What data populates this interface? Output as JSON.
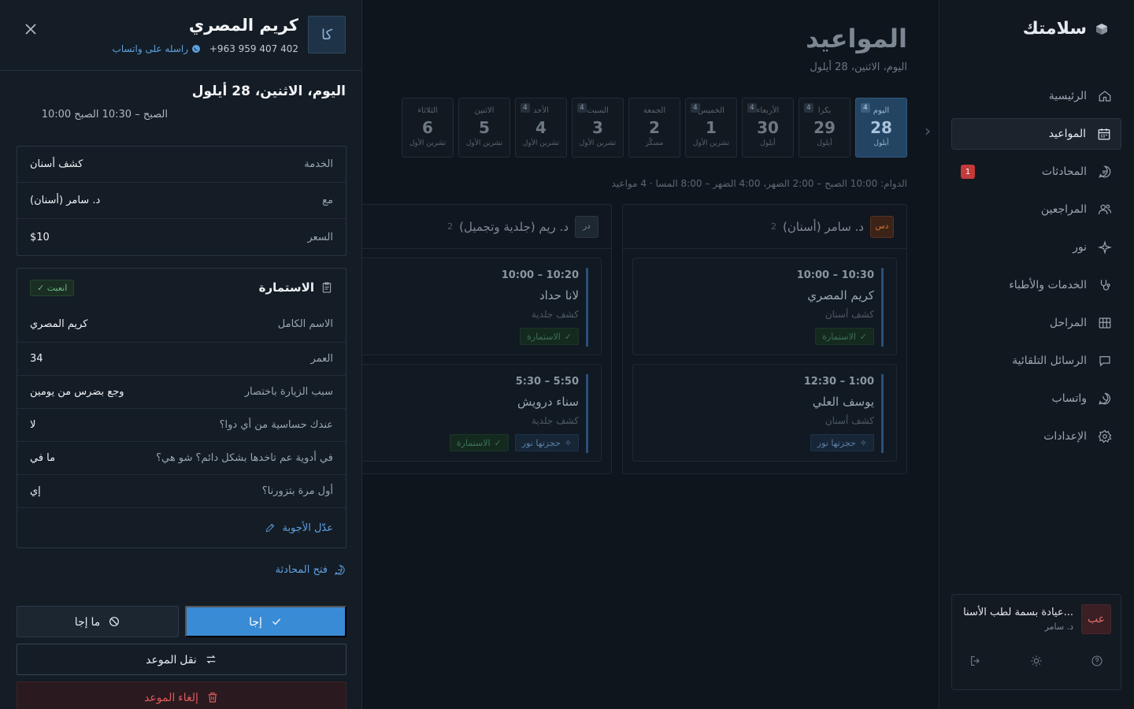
{
  "sidebar": {
    "brand": "سلامتك",
    "items": [
      {
        "label": "الرئيسية",
        "icon": "home-icon"
      },
      {
        "label": "المواعيد",
        "icon": "calendar-icon",
        "active": true
      },
      {
        "label": "المحادثات",
        "icon": "chat-icon",
        "badge": "1"
      },
      {
        "label": "المراجعين",
        "icon": "users-icon"
      },
      {
        "label": "نور",
        "icon": "sparkle-icon"
      },
      {
        "label": "الخدمات والأطباء",
        "icon": "stethoscope-icon"
      },
      {
        "label": "المراحل",
        "icon": "kanban-icon"
      },
      {
        "label": "الرسائل التلقائية",
        "icon": "message-icon"
      },
      {
        "label": "واتساب",
        "icon": "whatsapp-icon"
      },
      {
        "label": "الإعدادات",
        "icon": "gear-icon"
      }
    ],
    "clinic": {
      "avatar": "عب",
      "name": "عيادة بسمة لطب الأسنا...",
      "doctor": "د. سامر"
    }
  },
  "main": {
    "title": "المواعيد",
    "subtitle": "اليوم، الاثنين، 28 أيلول",
    "days": [
      {
        "name": "اليوم",
        "num": "28",
        "month": "أيلول",
        "count": "4",
        "today": true
      },
      {
        "name": "بكرا",
        "num": "29",
        "month": "أيلول",
        "count": "4"
      },
      {
        "name": "الأربعاء",
        "num": "30",
        "month": "أيلول",
        "count": "4"
      },
      {
        "name": "الخميس",
        "num": "1",
        "month": "تشرين الأول",
        "count": "4"
      },
      {
        "name": "الجمعة",
        "num": "2",
        "month": "مسكّر",
        "count": ""
      },
      {
        "name": "السبت",
        "num": "3",
        "month": "تشرين الأول",
        "count": "4"
      },
      {
        "name": "الأحد",
        "num": "4",
        "month": "تشرين الأول",
        "count": "4"
      },
      {
        "name": "الاثنين",
        "num": "5",
        "month": "تشرين الأول",
        "count": ""
      },
      {
        "name": "الثلاثاء",
        "num": "6",
        "month": "تشرين الأول",
        "count": ""
      }
    ],
    "hours": "الدوام: 10:00 الصبح – 2:00 الضهر، 4:00 الضهر – 8:00 المسا · 4 مواعيد",
    "columns": [
      {
        "avatar": "دس",
        "name": "د. سامر (أسنان)",
        "count": "2",
        "appointments": [
          {
            "time": "10:00 – 10:30",
            "name": "كريم المصري",
            "service": "كشف أسنان",
            "tags": [
              "الاستمارة"
            ]
          },
          {
            "time": "12:30 – 1:00",
            "name": "يوسف العلي",
            "service": "كشف أسنان",
            "tags": [
              "حجزتها نور"
            ]
          }
        ]
      },
      {
        "avatar": "در",
        "name": "د. ريم (جلدية وتجميل)",
        "count": "2",
        "appointments": [
          {
            "time": "10:00 – 10:20",
            "name": "لانا حداد",
            "service": "كشف جلدية",
            "tags": [
              "الاستمارة"
            ]
          },
          {
            "time": "5:30 – 5:50",
            "name": "سناء درويش",
            "service": "كشف جلدية",
            "tags": [
              "حجزتها نور",
              "الاستمارة"
            ]
          }
        ]
      }
    ]
  },
  "drawer": {
    "avatar": "كا",
    "name": "كريم المصري",
    "phone": "+963 959 407 402",
    "whatsapp_link": "راسله على واتساب",
    "date": "اليوم، الاثنين، 28 أيلول",
    "time": "10:00 الصبح – 10:30 الصبح",
    "details": [
      {
        "k": "الخدمة",
        "v": "كشف أسنان"
      },
      {
        "k": "مع",
        "v": "د. سامر (أسنان)"
      },
      {
        "k": "السعر",
        "v": "$10"
      }
    ],
    "form": {
      "title": "الاستمارة",
      "status": "✓ انعبت",
      "rows": [
        {
          "k": "الاسم الكامل",
          "v": "كريم المصري"
        },
        {
          "k": "العمر",
          "v": "34"
        },
        {
          "k": "سبب الزيارة باختصار",
          "v": "وجع بضرس من يومين"
        },
        {
          "k": "عندك حساسية من أي دوا؟",
          "v": "لا"
        },
        {
          "k": "في أدوية عم تاخدها بشكل دائم؟ شو هي؟",
          "v": "ما في"
        },
        {
          "k": "أول مرة بتزورنا؟",
          "v": "إي"
        }
      ],
      "edit": "عدّل الأجوبة"
    },
    "open_chat": "فتح المحادثة",
    "buttons": {
      "came": "إجا",
      "not_came": "ما إجا",
      "move": "نقل الموعد",
      "cancel": "إلغاء الموعد"
    }
  },
  "colors": {
    "accent": "#3a8bd6",
    "danger": "#e05a5a",
    "success": "#6fba86"
  }
}
